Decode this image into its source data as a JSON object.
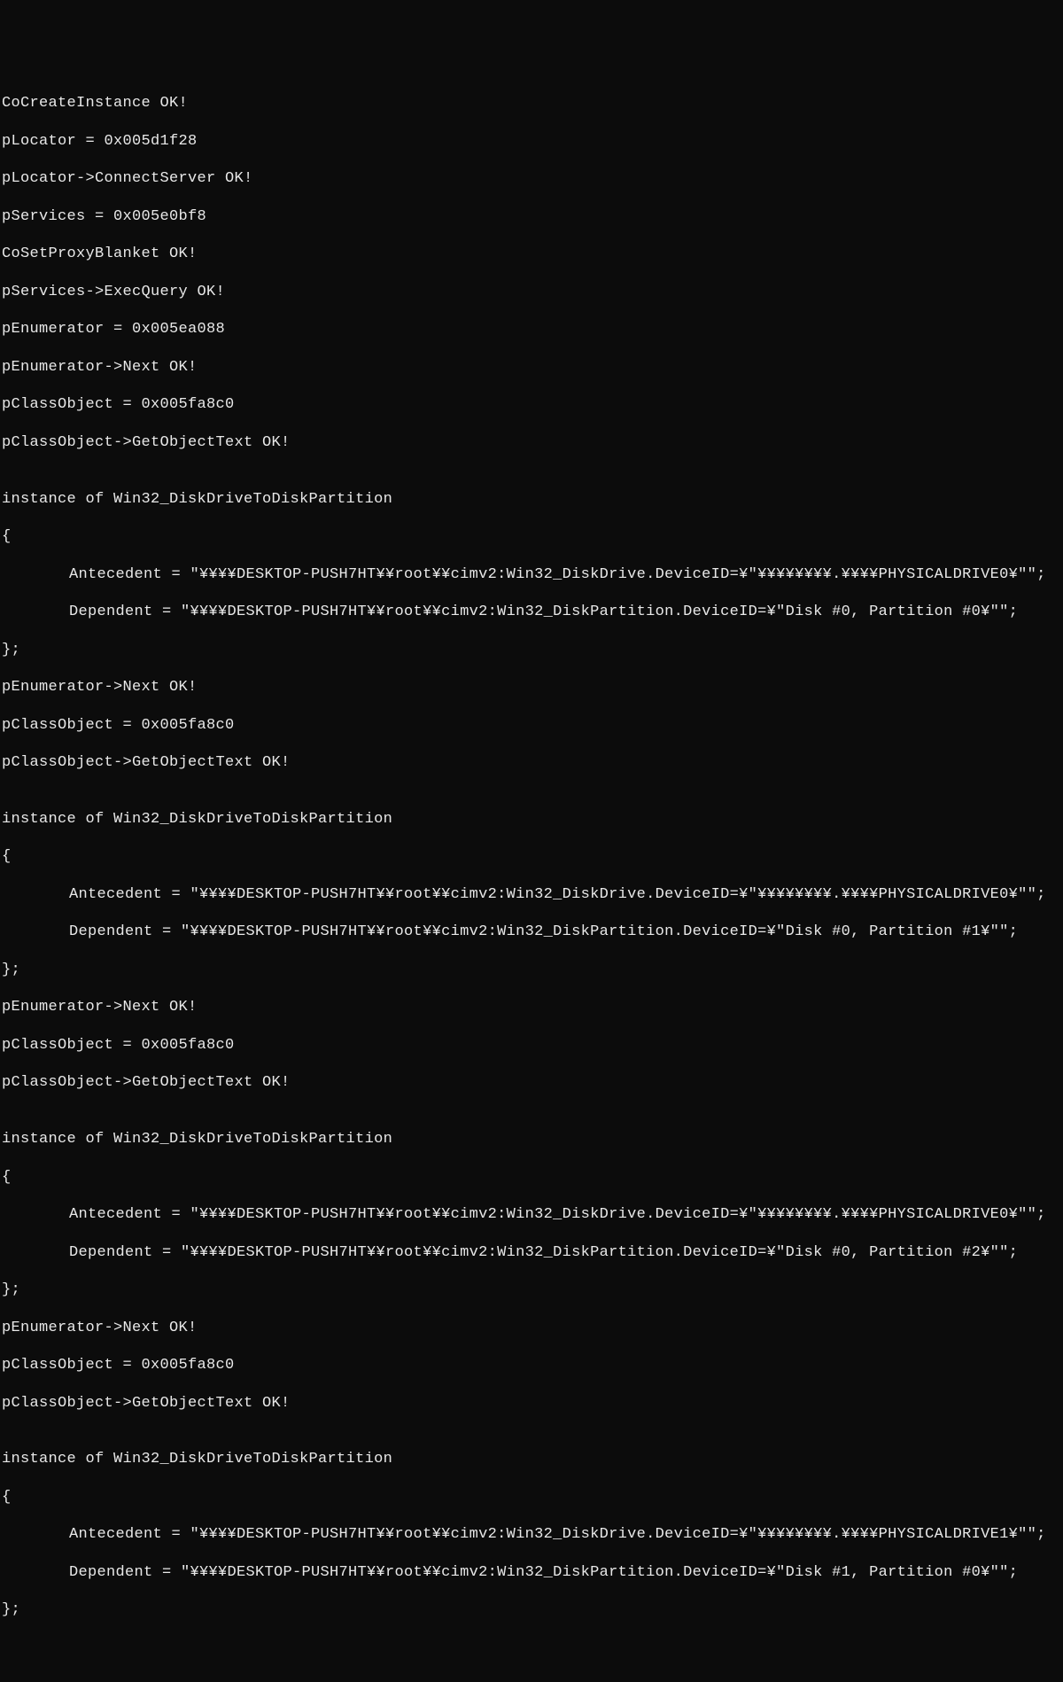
{
  "init": {
    "ln1": "CoCreateInstance OK!",
    "ln2": "pLocator = 0x005d1f28",
    "ln3": "pLocator->ConnectServer OK!",
    "ln4": "pServices = 0x005e0bf8",
    "ln5": "CoSetProxyBlanket OK!",
    "ln6": "pServices->ExecQuery OK!",
    "ln7": "pEnumerator = 0x005ea088",
    "ln8": "pEnumerator->Next OK!",
    "ln9": "pClassObject = 0x005fa8c0",
    "ln10": "pClassObject->GetObjectText OK!"
  },
  "blocks": [
    {
      "blank": "",
      "header": "instance of Win32_DiskDriveToDiskPartition",
      "open": "{",
      "antecedent": "Antecedent = \"¥¥¥¥DESKTOP-PUSH7HT¥¥root¥¥cimv2:Win32_DiskDrive.DeviceID=¥\"¥¥¥¥¥¥¥¥.¥¥¥¥PHYSICALDRIVE0¥\"\";",
      "dependent": "Dependent = \"¥¥¥¥DESKTOP-PUSH7HT¥¥root¥¥cimv2:Win32_DiskPartition.DeviceID=¥\"Disk #0, Partition #0¥\"\";",
      "close": "};",
      "next": "pEnumerator->Next OK!",
      "obj": "pClassObject = 0x005fa8c0",
      "gettext": "pClassObject->GetObjectText OK!"
    },
    {
      "blank": "",
      "header": "instance of Win32_DiskDriveToDiskPartition",
      "open": "{",
      "antecedent": "Antecedent = \"¥¥¥¥DESKTOP-PUSH7HT¥¥root¥¥cimv2:Win32_DiskDrive.DeviceID=¥\"¥¥¥¥¥¥¥¥.¥¥¥¥PHYSICALDRIVE0¥\"\";",
      "dependent": "Dependent = \"¥¥¥¥DESKTOP-PUSH7HT¥¥root¥¥cimv2:Win32_DiskPartition.DeviceID=¥\"Disk #0, Partition #1¥\"\";",
      "close": "};",
      "next": "pEnumerator->Next OK!",
      "obj": "pClassObject = 0x005fa8c0",
      "gettext": "pClassObject->GetObjectText OK!"
    },
    {
      "blank": "",
      "header": "instance of Win32_DiskDriveToDiskPartition",
      "open": "{",
      "antecedent": "Antecedent = \"¥¥¥¥DESKTOP-PUSH7HT¥¥root¥¥cimv2:Win32_DiskDrive.DeviceID=¥\"¥¥¥¥¥¥¥¥.¥¥¥¥PHYSICALDRIVE0¥\"\";",
      "dependent": "Dependent = \"¥¥¥¥DESKTOP-PUSH7HT¥¥root¥¥cimv2:Win32_DiskPartition.DeviceID=¥\"Disk #0, Partition #2¥\"\";",
      "close": "};",
      "next": "pEnumerator->Next OK!",
      "obj": "pClassObject = 0x005fa8c0",
      "gettext": "pClassObject->GetObjectText OK!"
    },
    {
      "blank": "",
      "header": "instance of Win32_DiskDriveToDiskPartition",
      "open": "{",
      "antecedent": "Antecedent = \"¥¥¥¥DESKTOP-PUSH7HT¥¥root¥¥cimv2:Win32_DiskDrive.DeviceID=¥\"¥¥¥¥¥¥¥¥.¥¥¥¥PHYSICALDRIVE1¥\"\";",
      "dependent": "Dependent = \"¥¥¥¥DESKTOP-PUSH7HT¥¥root¥¥cimv2:Win32_DiskPartition.DeviceID=¥\"Disk #1, Partition #0¥\"\";",
      "close": "};"
    }
  ]
}
